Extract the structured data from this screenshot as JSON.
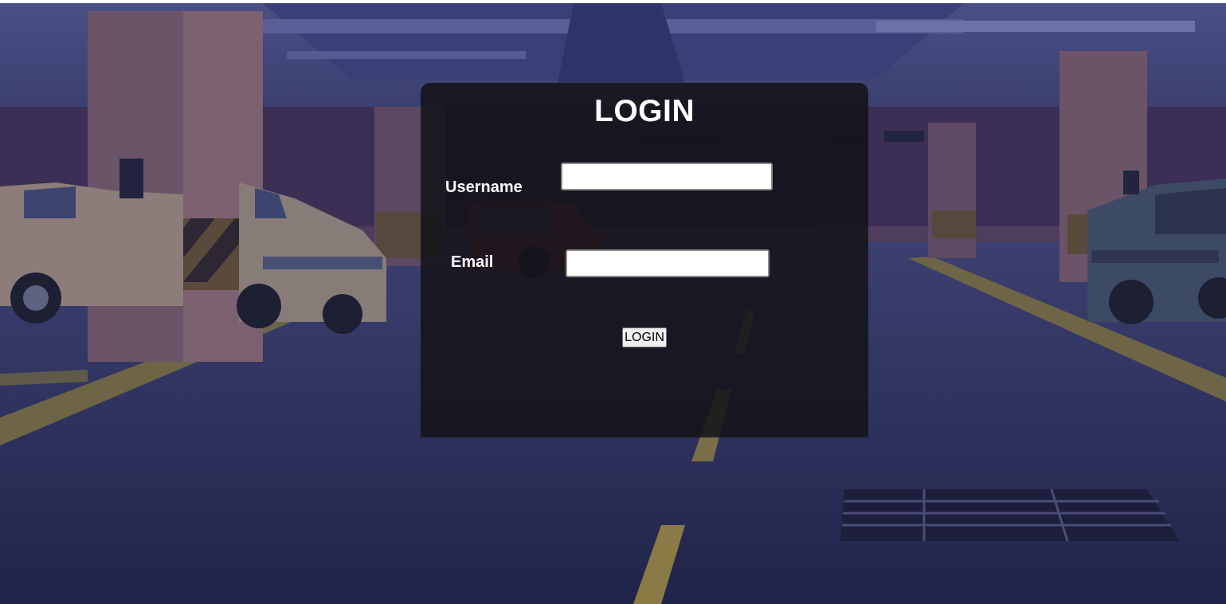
{
  "background": {
    "scene": "underground parking garage",
    "tint": "#23254f"
  },
  "login": {
    "title": "LOGIN",
    "username_label": "Username",
    "username_value": "",
    "email_label": "Email",
    "email_value": "",
    "button_label": "LOGIN"
  }
}
